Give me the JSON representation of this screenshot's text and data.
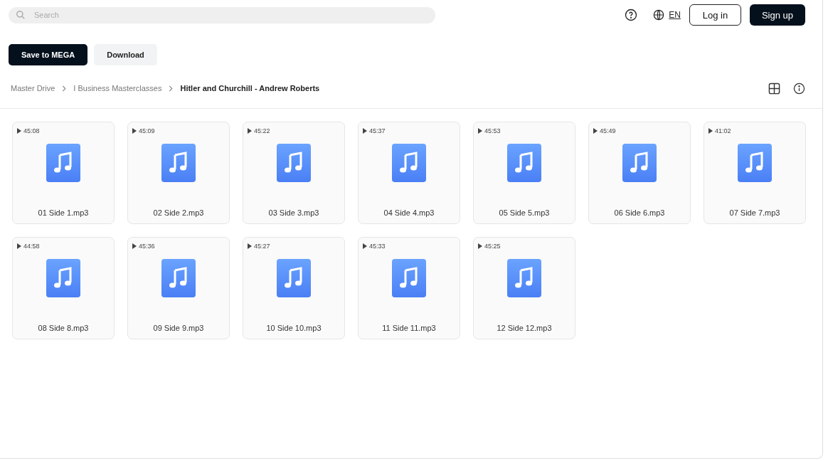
{
  "search": {
    "placeholder": "Search"
  },
  "header": {
    "language": "EN",
    "login": "Log in",
    "signup": "Sign up"
  },
  "actions": [
    "Save to MEGA",
    "Download"
  ],
  "breadcrumb": [
    {
      "label": "Master Drive",
      "current": false
    },
    {
      "label": "I Business Masterclasses",
      "current": false
    },
    {
      "label": "Hitler and Churchill - Andrew Roberts",
      "current": true
    }
  ],
  "files": [
    {
      "duration": "45:08",
      "name": "01 Side 1.mp3"
    },
    {
      "duration": "45:09",
      "name": "02 Side 2.mp3"
    },
    {
      "duration": "45:22",
      "name": "03 Side 3.mp3"
    },
    {
      "duration": "45:37",
      "name": "04 Side 4.mp3"
    },
    {
      "duration": "45:53",
      "name": "05 Side 5.mp3"
    },
    {
      "duration": "45:49",
      "name": "06 Side 6.mp3"
    },
    {
      "duration": "41:02",
      "name": "07 Side 7.mp3"
    },
    {
      "duration": "44:58",
      "name": "08 Side 8.mp3"
    },
    {
      "duration": "45:36",
      "name": "09 Side 9.mp3"
    },
    {
      "duration": "45:27",
      "name": "10 Side 10.mp3"
    },
    {
      "duration": "45:33",
      "name": "11 Side 11.mp3"
    },
    {
      "duration": "45:25",
      "name": "12 Side 12.mp3"
    }
  ]
}
